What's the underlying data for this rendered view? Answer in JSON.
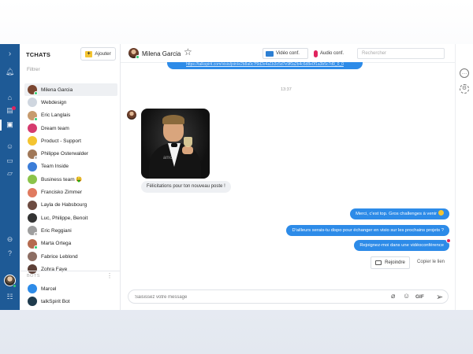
{
  "rail": {
    "icons": [
      "chevron-right-icon",
      "bell-icon",
      "home-icon",
      "calendar-icon",
      "chat-icon",
      "users-icon",
      "cards-icon",
      "folder-icon",
      "logout-icon",
      "help-icon",
      "settings-sliders-icon"
    ],
    "accent": "#1e5a96"
  },
  "list": {
    "title": "TCHATS",
    "add_label": "Ajouter",
    "filter_placeholder": "Filtrer",
    "contacts": [
      {
        "name": "Milena Garcia",
        "avatar_color": "#7a4630",
        "status_color": "#2ecc71",
        "selected": true
      },
      {
        "name": "Webdesign",
        "avatar_color": "#cfd6df",
        "status_color": "",
        "selected": false
      },
      {
        "name": "Eric Langlais",
        "avatar_color": "#c79b6e",
        "status_color": "#2ecc71",
        "selected": false
      },
      {
        "name": "Dream team",
        "avatar_color": "#d63b6e",
        "status_color": "",
        "selected": false
      },
      {
        "name": "Product - Support",
        "avatar_color": "#f4c430",
        "status_color": "",
        "selected": false
      },
      {
        "name": "Philippe Osterwalder",
        "avatar_color": "#a07858",
        "status_color": "#bbbbbb",
        "selected": false
      },
      {
        "name": "Team Inside",
        "avatar_color": "#3b7dd8",
        "status_color": "",
        "selected": false
      },
      {
        "name": "Business team 🤑",
        "avatar_color": "#8bc34a",
        "status_color": "",
        "selected": false
      },
      {
        "name": "Francisko Zimmer",
        "avatar_color": "#e07a5f",
        "status_color": "",
        "selected": false
      },
      {
        "name": "Layla de Habsbourg",
        "avatar_color": "#6d4c41",
        "status_color": "",
        "selected": false
      },
      {
        "name": "Luc, Philippe, Benoit",
        "avatar_color": "#333333",
        "status_color": "",
        "selected": false
      },
      {
        "name": "Eric Reggiani",
        "avatar_color": "#9e9e9e",
        "status_color": "#bbbbbb",
        "selected": false
      },
      {
        "name": "Marta Ortega",
        "avatar_color": "#b56b4f",
        "status_color": "#2ecc71",
        "selected": false
      },
      {
        "name": "Fabrice Leblond",
        "avatar_color": "#8d6e63",
        "status_color": "",
        "selected": false
      },
      {
        "name": "Zohra Faye",
        "avatar_color": "#5d4037",
        "status_color": "",
        "selected": false
      }
    ],
    "bots_label": "BOTS",
    "bots": [
      {
        "name": "Marcel",
        "avatar_color": "#2d8be8"
      },
      {
        "name": "talkSpirit Bot",
        "avatar_color": "#1f3b4d"
      }
    ]
  },
  "chat": {
    "contact_name": "Milena Garcia",
    "video_label": "Vidéo conf.",
    "audio_label": "Audio conf.",
    "search_placeholder": "Rechercher",
    "link_text": "https://talkspirit.com/visio/join/e2b8a0c7f9d2e4a1b3c5d7e9f0a2b4c6d8e0f1a3b5c7d9_0_0",
    "time_divider": "13:37",
    "gif_watermark": "amc",
    "received_message": "Félicitations pour ton nouveau poste !",
    "sent_messages": [
      {
        "text": "Merci, c'est top. Gros challenges à venir",
        "emoji": true,
        "badge": false
      },
      {
        "text": "D'ailleurs serais-tu dispo pour échanger en visio sur les prochains projets ?",
        "emoji": false,
        "badge": false
      },
      {
        "text": "Rejoignez-moi dans une vidéoconférence",
        "emoji": false,
        "badge": true
      }
    ],
    "join_label": "Rejoindre",
    "copy_link_label": "Copier le lien",
    "composer_placeholder": "Saisissez votre message",
    "gif_label": "GIF",
    "bubble_color": "#2d8be8"
  }
}
